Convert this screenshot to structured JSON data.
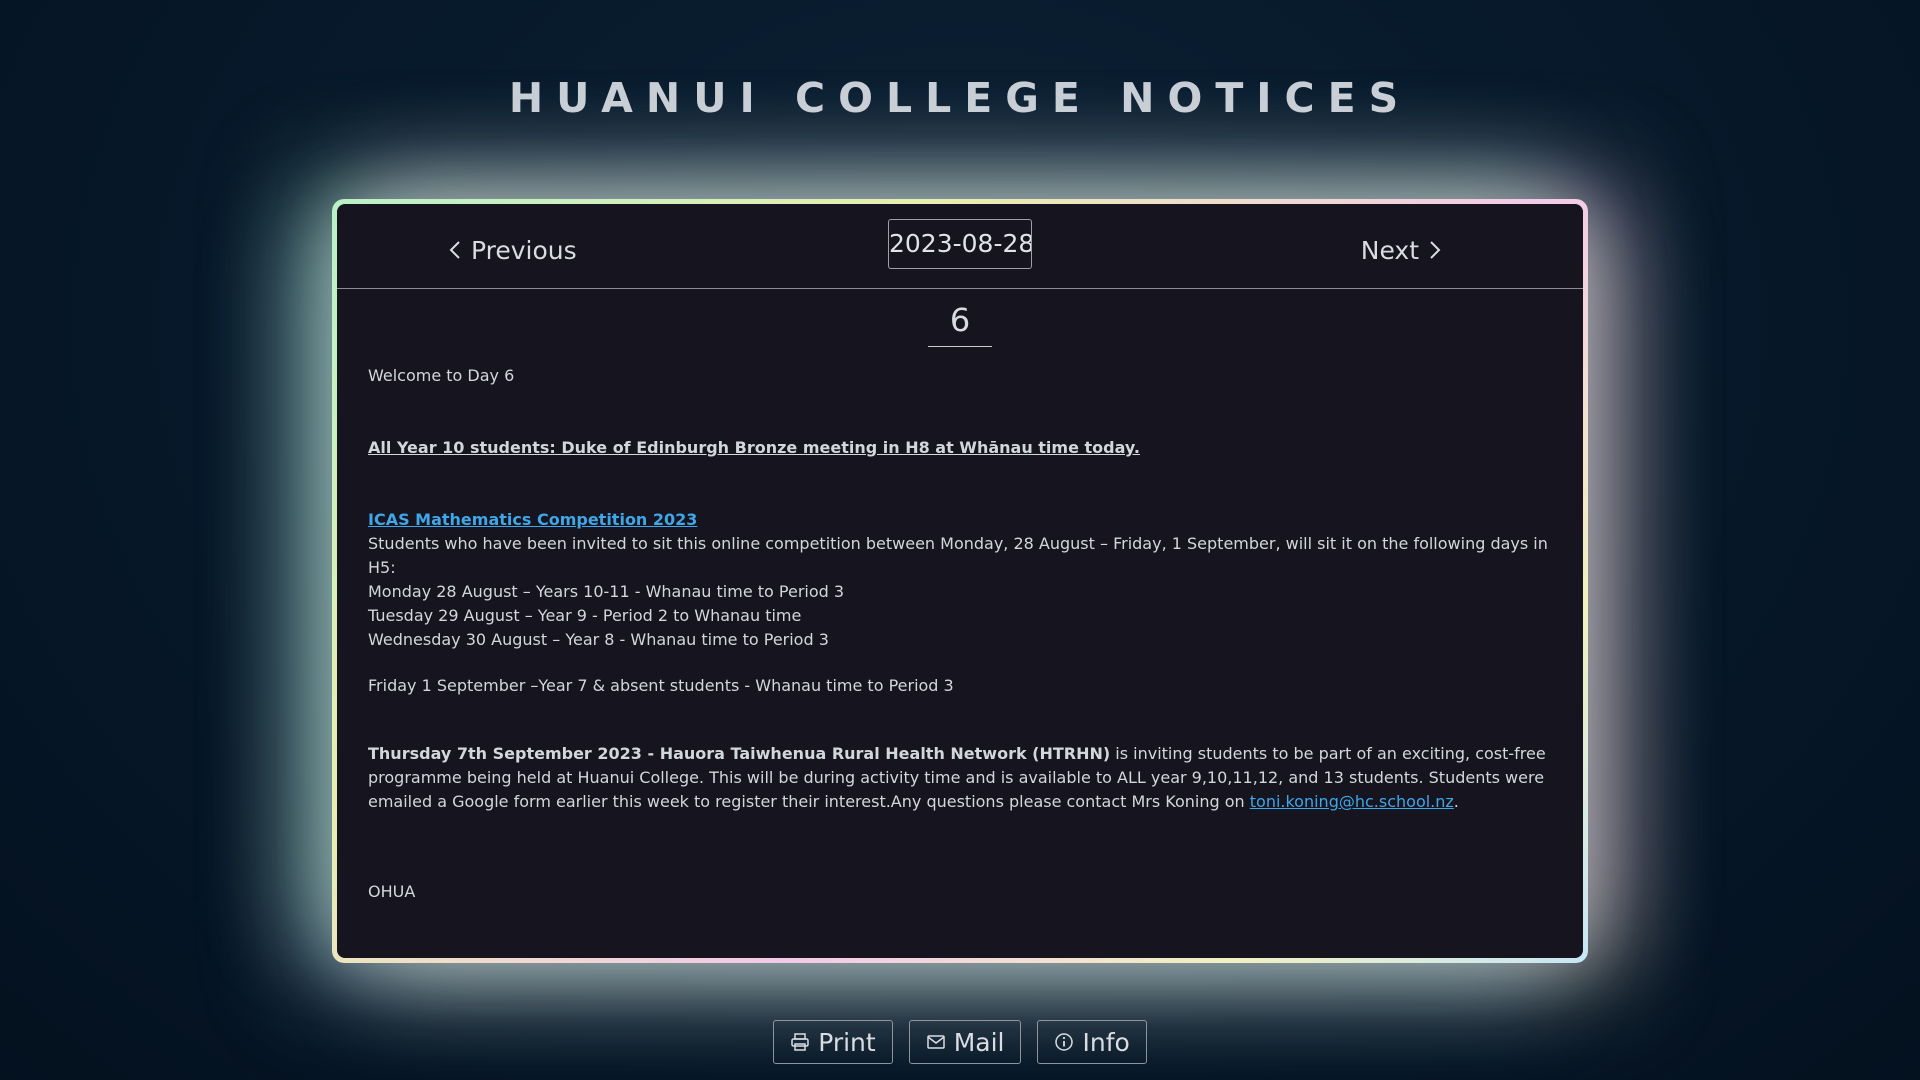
{
  "page": {
    "title": "HUANUI COLLEGE NOTICES"
  },
  "nav": {
    "previous_label": "Previous",
    "next_label": "Next",
    "date_value": "2023-08-28"
  },
  "day": {
    "number": "6"
  },
  "notices": {
    "welcome": "Welcome to Day 6",
    "year10_notice": "All Year 10 students: Duke of Edinburgh Bronze meeting in H8 at Whānau time today.",
    "icas": {
      "heading": "ICAS Mathematics Competition 2023",
      "intro": "Students who have been invited to sit this online competition between Monday, 28 August – Friday, 1 September, will sit it on the following days in H5:",
      "schedule": [
        "Monday 28 August – Years 10-11 - Whanau time to Period 3",
        "Tuesday 29 August – Year 9 - Period 2 to Whanau time",
        "Wednesday 30 August – Year 8 - Whanau time to Period 3",
        "Friday 1 September –Year 7 & absent students - Whanau time to Period 3"
      ]
    },
    "health": {
      "bold_lead": "Thursday 7th September 2023 - Hauora Taiwhenua Rural Health Network (HTRHN)",
      "body": " is inviting students to be part of an exciting, cost-free programme being held at Huanui College.  This will be during activity time and is available to ALL year 9,10,11,12, and 13 students. Students were emailed a Google form earlier this week to register their interest.Any questions please contact Mrs Koning on ",
      "email": "toni.koning@hc.school.nz",
      "trailing": "."
    },
    "signoff": "OHUA"
  },
  "footer": {
    "print_label": "Print",
    "mail_label": "Mail",
    "info_label": "Info"
  },
  "icons": {
    "previous": "chevron-left-icon",
    "next": "chevron-right-icon",
    "print": "printer-icon",
    "mail": "envelope-icon",
    "info": "info-circle-icon"
  },
  "colors": {
    "background": "#071a2c",
    "card": "#15141f",
    "link": "#3fa6e8",
    "text": "#d3d7dc"
  }
}
